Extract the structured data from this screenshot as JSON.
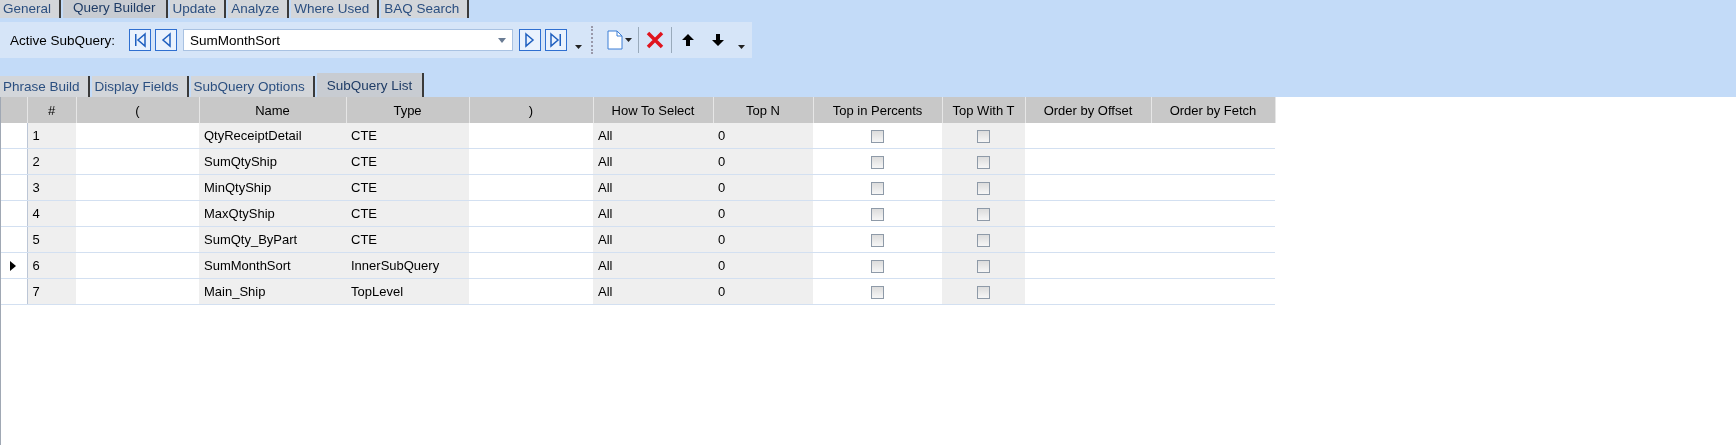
{
  "main_tabs": [
    {
      "label": "General",
      "selected": false
    },
    {
      "label": "Query Builder",
      "selected": true
    },
    {
      "label": "Update",
      "selected": false
    },
    {
      "label": "Analyze",
      "selected": false
    },
    {
      "label": "Where Used",
      "selected": false
    },
    {
      "label": "BAQ Search",
      "selected": false
    }
  ],
  "toolbar": {
    "label": "Active SubQuery:",
    "combo_value": "SumMonthSort"
  },
  "sub_tabs": [
    {
      "label": "Phrase Build",
      "selected": false
    },
    {
      "label": "Display Fields",
      "selected": false
    },
    {
      "label": "SubQuery Options",
      "selected": false
    },
    {
      "label": "SubQuery List",
      "selected": true
    }
  ],
  "grid": {
    "columns": [
      {
        "label": "#",
        "kind": "text",
        "shaded": true
      },
      {
        "label": "(",
        "kind": "text",
        "shaded": false
      },
      {
        "label": "Name",
        "kind": "text",
        "shaded": true
      },
      {
        "label": "Type",
        "kind": "text",
        "shaded": true
      },
      {
        "label": ")",
        "kind": "text",
        "shaded": false
      },
      {
        "label": "How To Select",
        "kind": "text",
        "shaded": true
      },
      {
        "label": "Top N",
        "kind": "text",
        "shaded": true
      },
      {
        "label": "Top in Percents",
        "kind": "check",
        "shaded": false
      },
      {
        "label": "Top With T",
        "kind": "check",
        "shaded": true
      },
      {
        "label": "Order by Offset",
        "kind": "text",
        "shaded": false
      },
      {
        "label": "Order by Fetch",
        "kind": "text",
        "shaded": false
      }
    ],
    "rows": [
      {
        "current": false,
        "cells": [
          "1",
          null,
          "QtyReceiptDetail",
          "CTE",
          null,
          "All",
          "0",
          false,
          false,
          null,
          null
        ]
      },
      {
        "current": false,
        "cells": [
          "2",
          null,
          "SumQtyShip",
          "CTE",
          null,
          "All",
          "0",
          false,
          false,
          null,
          null
        ]
      },
      {
        "current": false,
        "cells": [
          "3",
          null,
          "MinQtyShip",
          "CTE",
          null,
          "All",
          "0",
          false,
          false,
          null,
          null
        ]
      },
      {
        "current": false,
        "cells": [
          "4",
          null,
          "MaxQtyShip",
          "CTE",
          null,
          "All",
          "0",
          false,
          false,
          null,
          null
        ]
      },
      {
        "current": false,
        "cells": [
          "5",
          null,
          "SumQty_ByPart",
          "CTE",
          null,
          "All",
          "0",
          false,
          false,
          null,
          null
        ]
      },
      {
        "current": true,
        "cells": [
          "6",
          null,
          "SumMonthSort",
          "InnerSubQuery",
          null,
          "All",
          "0",
          false,
          false,
          null,
          null
        ]
      },
      {
        "current": false,
        "cells": [
          "7",
          null,
          "Main_Ship",
          "TopLevel",
          null,
          "All",
          "0",
          false,
          false,
          null,
          null
        ]
      }
    ]
  }
}
